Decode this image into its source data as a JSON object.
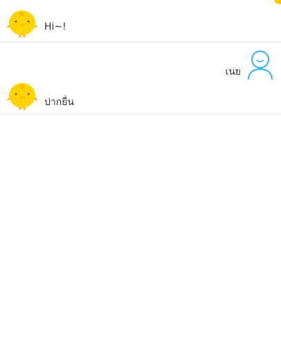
{
  "colors": {
    "bot_yellow": "#ffd400",
    "bot_orange": "#f0a500",
    "user_blue": "#3fb6e6",
    "divider": "#e6e6e6",
    "text": "#333333"
  },
  "chat": {
    "messages": [
      {
        "sender": "bot",
        "avatar_icon": "simsimi-chick-icon",
        "text": "Hi~!"
      },
      {
        "sender": "user",
        "avatar_icon": "user-silhouette-icon",
        "text": "เนย"
      },
      {
        "sender": "bot",
        "avatar_icon": "simsimi-chick-icon",
        "text": "ปากยื่น"
      }
    ]
  }
}
